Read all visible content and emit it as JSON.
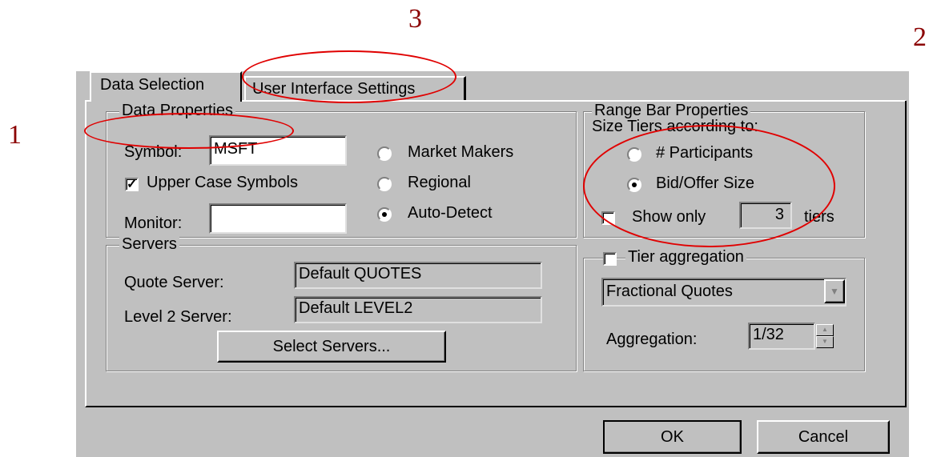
{
  "annotations": {
    "one": "1",
    "two": "2",
    "three": "3"
  },
  "tabs": {
    "data_selection": "Data Selection",
    "ui_settings": "User Interface Settings"
  },
  "data_properties": {
    "title": "Data Properties",
    "symbol_label": "Symbol:",
    "symbol_value": "MSFT",
    "upper_case_label": "Upper Case Symbols",
    "upper_case_checked": true,
    "monitor_label": "Monitor:",
    "monitor_value": "",
    "radio_market_makers": "Market Makers",
    "radio_regional": "Regional",
    "radio_auto_detect": "Auto-Detect",
    "selected_radio": "Auto-Detect"
  },
  "servers": {
    "title": "Servers",
    "quote_label": "Quote Server:",
    "quote_value": "Default QUOTES",
    "level2_label": "Level 2 Server:",
    "level2_value": "Default LEVEL2",
    "select_button": "Select Servers..."
  },
  "range_bar": {
    "title": "Range Bar Properties",
    "size_tiers_label": "Size Tiers according to:",
    "radio_participants": "# Participants",
    "radio_bid_offer": "Bid/Offer Size",
    "selected_radio": "Bid/Offer Size",
    "show_only_label": "Show only",
    "show_only_checked": false,
    "tiers_value": "3",
    "tiers_label": "tiers"
  },
  "tier_aggregation": {
    "title": "Tier aggregation",
    "checked": false,
    "dropdown_value": "Fractional Quotes",
    "aggregation_label": "Aggregation:",
    "aggregation_value": "1/32"
  },
  "buttons": {
    "ok": "OK",
    "cancel": "Cancel"
  },
  "colors": {
    "dialog_bg": "#c0c0c0",
    "annotation_number": "#8b0000",
    "annotation_circle": "#e00000"
  }
}
